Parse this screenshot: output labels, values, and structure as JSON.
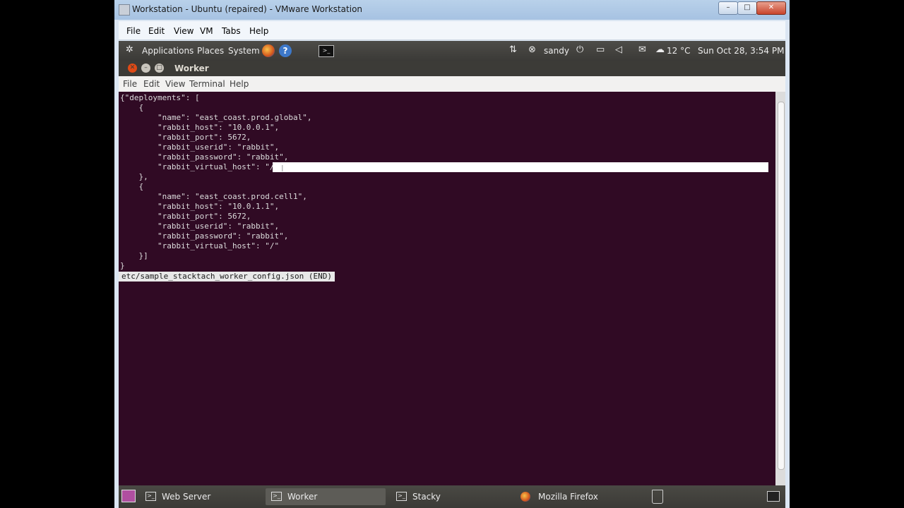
{
  "vmware": {
    "title": "Workstation - Ubuntu (repaired) - VMware Workstation",
    "window_buttons": [
      "–",
      "□",
      "✕"
    ],
    "menu": [
      "File",
      "Edit",
      "View",
      "VM",
      "Tabs",
      "Help"
    ]
  },
  "gnome_panel": {
    "menu": [
      "Applications",
      "Places",
      "System"
    ],
    "user": "sandy",
    "weather": "12 °C",
    "clock": "Sun Oct 28,  3:54 PM"
  },
  "terminal": {
    "title": "Worker",
    "menu": [
      "File",
      "Edit",
      "View",
      "Terminal",
      "Help"
    ],
    "lines": [
      "{\"deployments\": [",
      "    {",
      "        \"name\": \"east_coast.prod.global\",",
      "        \"rabbit_host\": \"10.0.0.1\",",
      "        \"rabbit_port\": 5672,",
      "        \"rabbit_userid\": \"rabbit\",",
      "        \"rabbit_password\": \"rabbit\",",
      "        \"rabbit_virtual_host\": \"/",
      "    },",
      "    {",
      "        \"name\": \"east_coast.prod.cell1\",",
      "        \"rabbit_host\": \"10.0.1.1\",",
      "        \"rabbit_port\": 5672,",
      "        \"rabbit_userid\": \"rabbit\",",
      "        \"rabbit_password\": \"rabbit\",",
      "        \"rabbit_virtual_host\": \"/\"",
      "    }]",
      "}"
    ],
    "status": "etc/sample_stacktach_worker_config.json (END)"
  },
  "taskbar": {
    "items": [
      "Web Server",
      "Worker",
      "Stacky",
      "Mozilla Firefox"
    ],
    "active_index": 1
  },
  "colors": {
    "terminal_bg": "#300a24",
    "panel_bg": "#3c3b37",
    "close": "#df4a16",
    "minimize": "#8a877e"
  }
}
